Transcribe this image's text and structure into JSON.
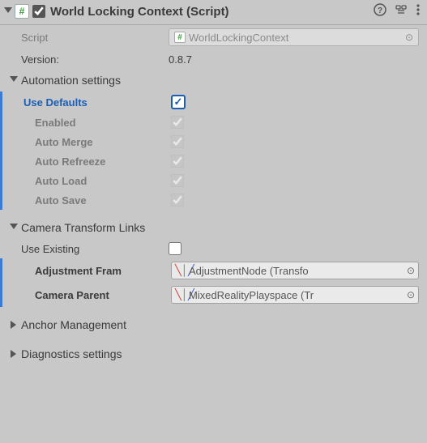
{
  "header": {
    "title": "World Locking Context (Script)",
    "enabled": true,
    "script_icon_char": "#",
    "help_tooltip": "Open Reference",
    "preset_tooltip": "Presets",
    "menu_tooltip": "Options"
  },
  "script": {
    "label": "Script",
    "value": "WorldLockingContext"
  },
  "version": {
    "label": "Version:",
    "value": "0.8.7"
  },
  "automation": {
    "section_label": "Automation settings",
    "use_defaults": {
      "label": "Use Defaults",
      "checked": true
    },
    "items": [
      {
        "label": "Enabled",
        "checked": true,
        "disabled": true
      },
      {
        "label": "Auto Merge",
        "checked": true,
        "disabled": true
      },
      {
        "label": "Auto Refreeze",
        "checked": true,
        "disabled": true
      },
      {
        "label": "Auto Load",
        "checked": true,
        "disabled": true
      },
      {
        "label": "Auto Save",
        "checked": true,
        "disabled": true
      }
    ]
  },
  "camera_links": {
    "section_label": "Camera Transform Links",
    "use_existing": {
      "label": "Use Existing",
      "checked": false
    },
    "adjustment": {
      "label": "Adjustment Fram",
      "value": "AdjustmentNode (Transfo"
    },
    "camera_parent": {
      "label": "Camera Parent",
      "value": "MixedRealityPlayspace (Tr"
    }
  },
  "anchor": {
    "section_label": "Anchor Management"
  },
  "diagnostics": {
    "section_label": "Diagnostics settings"
  }
}
